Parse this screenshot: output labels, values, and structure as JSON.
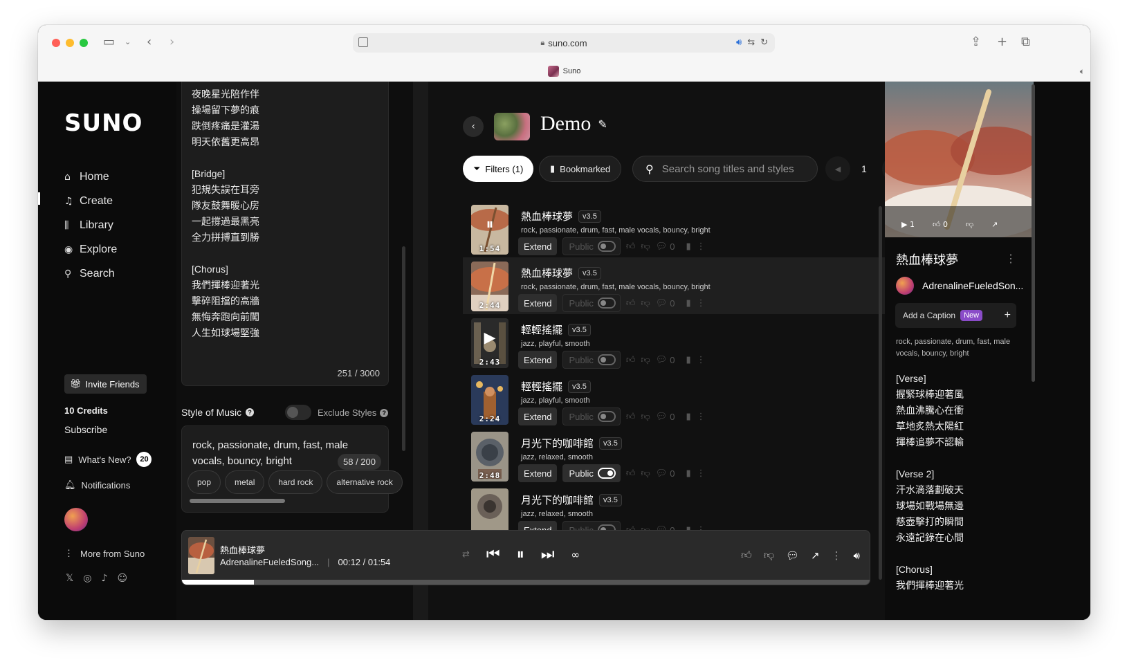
{
  "browser": {
    "url": "suno.com",
    "tab_title": "Suno"
  },
  "nav": {
    "logo": "SUNO",
    "items": [
      {
        "label": "Home",
        "icon": "home-icon",
        "glyph": "⌂"
      },
      {
        "label": "Create",
        "icon": "music-note-icon",
        "glyph": "♫"
      },
      {
        "label": "Library",
        "icon": "library-icon",
        "glyph": "⫼"
      },
      {
        "label": "Explore",
        "icon": "compass-icon",
        "glyph": "◉"
      },
      {
        "label": "Search",
        "icon": "search-icon",
        "glyph": "⚲"
      }
    ],
    "invite": "Invite Friends",
    "credits": "10 Credits",
    "subscribe": "Subscribe",
    "whats_new": "What's New?",
    "whats_new_count": "20",
    "notifications": "Notifications",
    "more_from_suno": "More from Suno"
  },
  "create": {
    "lyrics": "夜晚星光陪作伴\n操場留下夢的痕\n跌倒疼痛是灌湯\n明天依舊更高昂\n\n[Bridge]\n犯規失誤在耳旁\n隊友鼓舞暖心房\n一起撐過最黑亮\n全力拼搏直到勝\n\n[Chorus]\n我們揮棒迎著光\n擊碎阻擋的高牆\n無悔奔跑向前闖\n人生如球場堅強",
    "lyrics_count": "251 / 3000",
    "style_label": "Style of Music",
    "exclude_label": "Exclude Styles",
    "style_text": "rock,  passionate, drum, fast, male vocals, bouncy, bright",
    "style_count": "58 / 200",
    "chips": [
      "pop",
      "metal",
      "hard rock",
      "alternative rock"
    ]
  },
  "library": {
    "workspace_title": "Demo",
    "filters_label": "Filters (1)",
    "bookmarked_label": "Bookmarked",
    "search_placeholder": "Search song titles and styles",
    "page": "1",
    "songs": [
      {
        "title": "熱血棒球夢",
        "version": "v3.5",
        "tags": "rock, passionate, drum, fast, male vocals, bouncy, bright",
        "duration": "1:54",
        "extend": "Extend",
        "public": "Public",
        "public_on": false,
        "comments": "0",
        "playing": true
      },
      {
        "title": "熱血棒球夢",
        "version": "v3.5",
        "tags": "rock, passionate, drum, fast, male vocals, bouncy, bright",
        "duration": "2:44",
        "extend": "Extend",
        "public": "Public",
        "public_on": false,
        "comments": "0"
      },
      {
        "title": "輕輕搖擺",
        "version": "v3.5",
        "tags": "jazz, playful, smooth",
        "duration": "2:43",
        "extend": "Extend",
        "public": "Public",
        "public_on": false,
        "comments": "0"
      },
      {
        "title": "輕輕搖擺",
        "version": "v3.5",
        "tags": "jazz, playful, smooth",
        "duration": "2:24",
        "extend": "Extend",
        "public": "Public",
        "public_on": false,
        "comments": "0"
      },
      {
        "title": "月光下的咖啡館",
        "version": "v3.5",
        "tags": "jazz, relaxed, smooth",
        "duration": "2:48",
        "extend": "Extend",
        "public": "Public",
        "public_on": true,
        "comments": "0"
      },
      {
        "title": "月光下的咖啡館",
        "version": "v3.5",
        "tags": "jazz, relaxed, smooth",
        "duration": "",
        "extend": "Extend",
        "public": "Public",
        "public_on": false,
        "comments": "0"
      }
    ]
  },
  "player": {
    "title": "熱血棒球夢",
    "artist": "AdrenalineFueledSong...",
    "time": "00:12 / 01:54",
    "progress": 0.105
  },
  "detail": {
    "plays": "1",
    "likes": "0",
    "title": "熱血棒球夢",
    "artist": "AdrenalineFueledSon...",
    "caption": "Add a Caption",
    "new_badge": "New",
    "tags": "rock, passionate, drum, fast, male vocals, bouncy, bright",
    "lyrics": "[Verse]\n握緊球棒迎著風\n熱血沸騰心在衝\n草地炙熱太陽紅\n揮棒追夢不認輸\n\n[Verse 2]\n汗水滴落劃破天\n球場如戰場無邊\n慈壺擊打的瞬間\n永遠記錄在心間\n\n[Chorus]\n我們揮棒迎著光"
  },
  "colors": {
    "accent_new": "#8a4cc8",
    "bg": "#000000"
  }
}
